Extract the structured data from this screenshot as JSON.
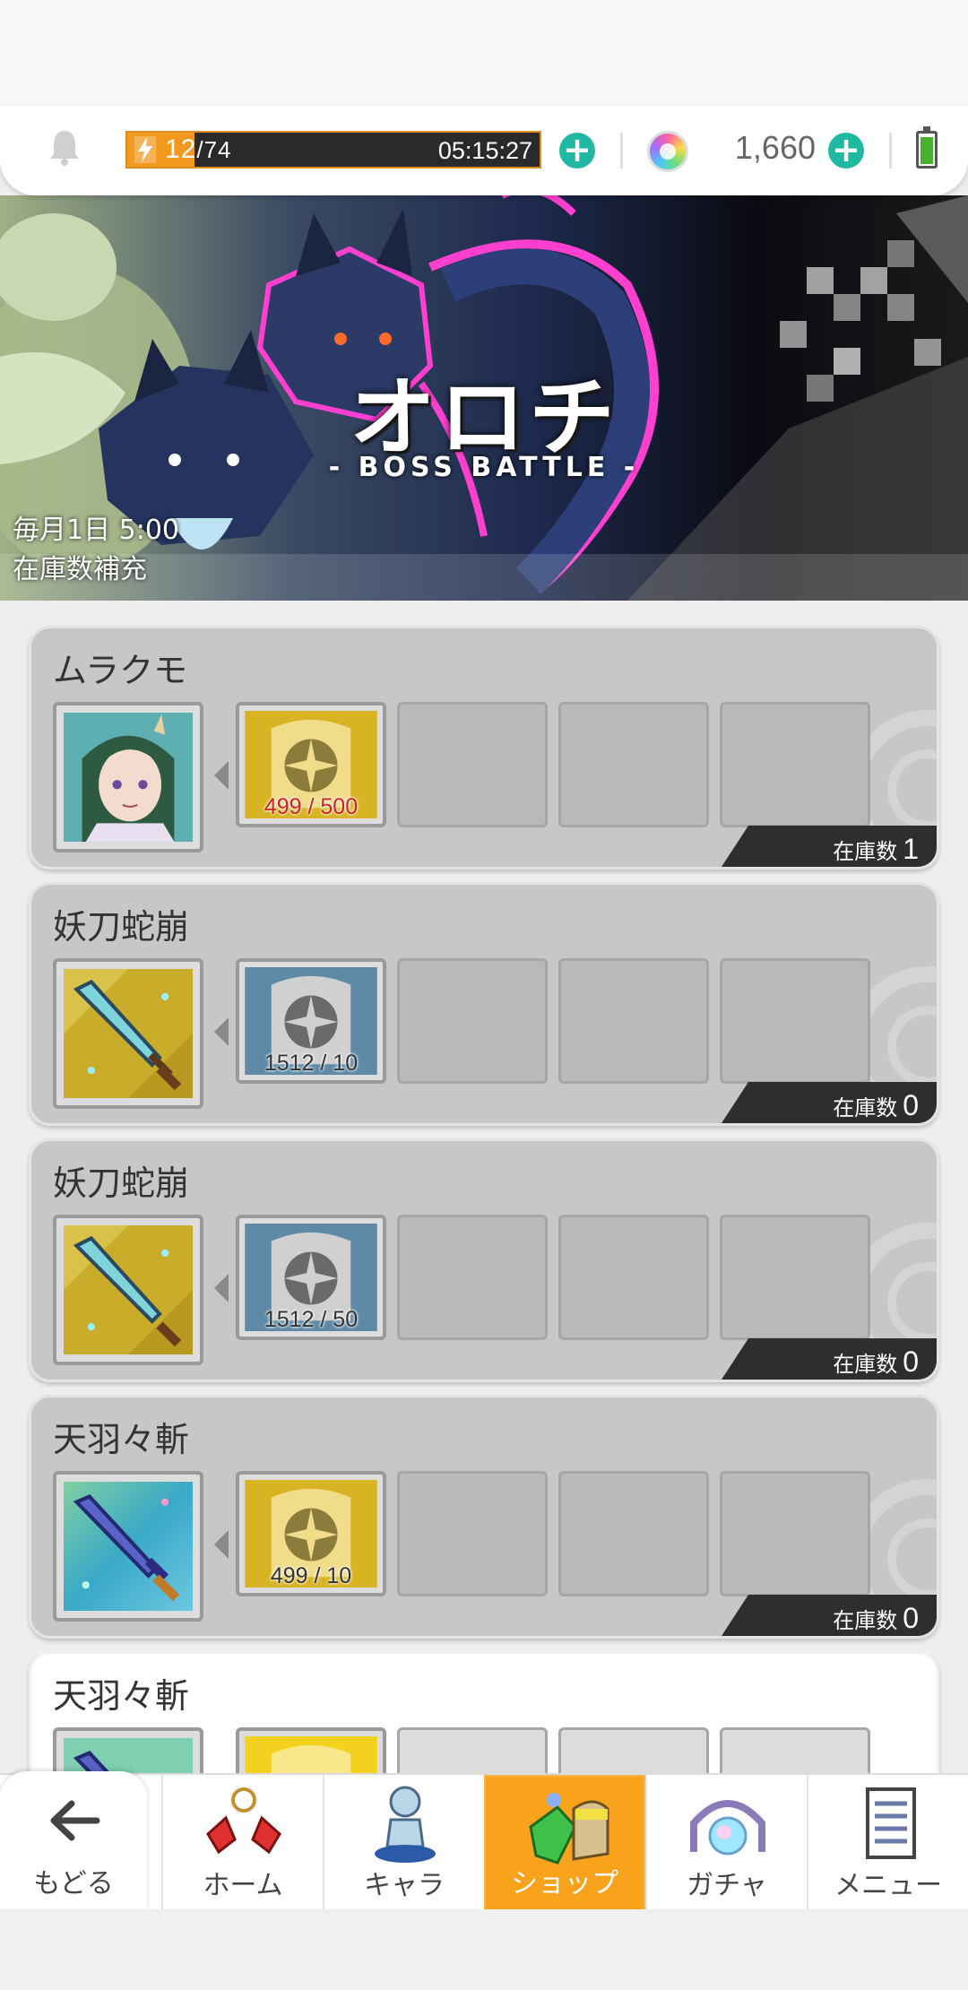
{
  "topbar": {
    "stamina_current": "12",
    "stamina_max": "/74",
    "stamina_fraction": 0.162,
    "stamina_timer": "05:15:27",
    "gems": "1,660"
  },
  "banner": {
    "title": "オロチ",
    "subtitle": "- BOSS BATTLE -",
    "restock_time": "毎月1日 5:00",
    "restock_label": "在庫数補充"
  },
  "cards": [
    {
      "name": "ムラクモ",
      "reward_icon": "character-portrait-icon",
      "cost_icon": "gold-medal-icon",
      "cost": "499 / 500",
      "cost_short": true,
      "stock_label": "在庫数",
      "stock": "1"
    },
    {
      "name": "妖刀蛇崩",
      "reward_icon": "sword-icon",
      "cost_icon": "silver-medal-icon",
      "cost": "1512 / 10",
      "cost_short": false,
      "stock_label": "在庫数",
      "stock": "0"
    },
    {
      "name": "妖刀蛇崩",
      "reward_icon": "sword-icon",
      "cost_icon": "silver-medal-icon",
      "cost": "1512 / 50",
      "cost_short": false,
      "stock_label": "在庫数",
      "stock": "0"
    },
    {
      "name": "天羽々斬",
      "reward_icon": "sword-icon",
      "cost_icon": "gold-medal-icon",
      "cost": "499 / 10",
      "cost_short": false,
      "stock_label": "在庫数",
      "stock": "0"
    },
    {
      "name": "天羽々斬",
      "reward_icon": "sword-icon",
      "cost_icon": "gold-medal-icon",
      "cost": "",
      "cost_short": false,
      "stock_label": "",
      "stock": ""
    }
  ],
  "nav": {
    "back": "もどる",
    "home": "ホーム",
    "chara": "キャラ",
    "shop": "ショップ",
    "gacha": "ガチャ",
    "menu": "メニュー",
    "active": "shop"
  },
  "colors": {
    "accent_teal": "#1fb8a0",
    "stamina_orange": "#f29a1f",
    "nav_active": "#f9a31d",
    "cost_short_red": "#d02020"
  }
}
